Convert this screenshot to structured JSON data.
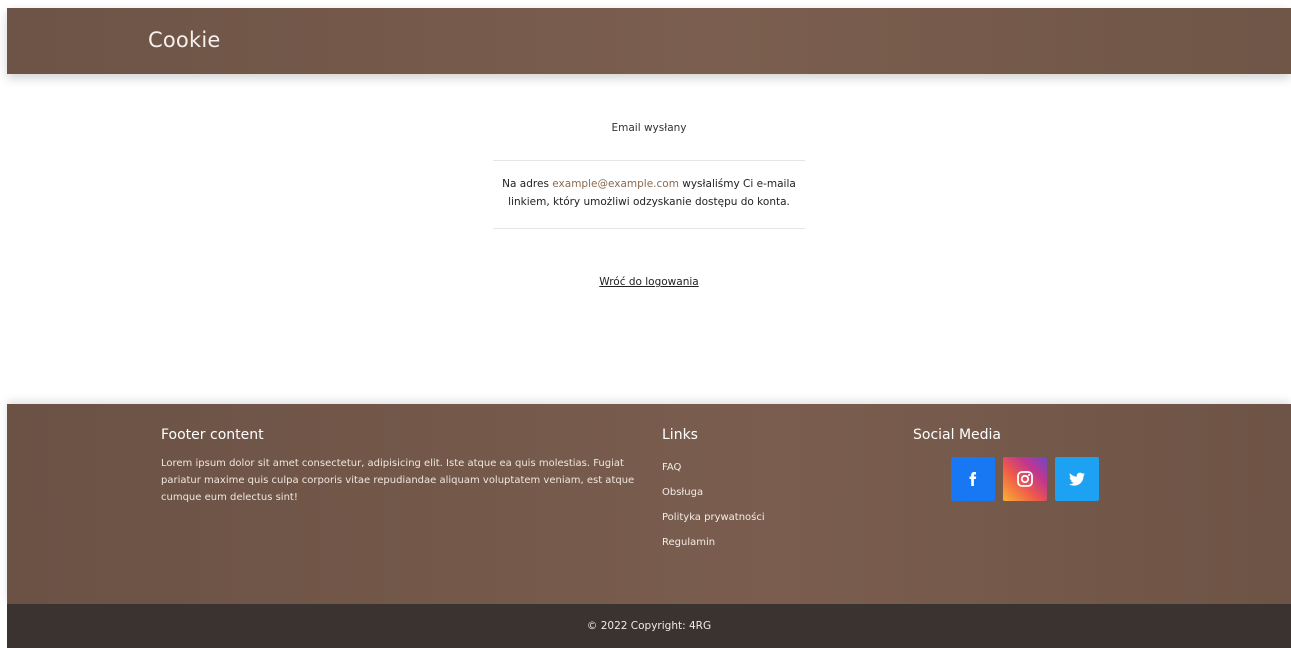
{
  "header": {
    "brand": "Cookie"
  },
  "main": {
    "title": "Email wysłany",
    "body_prefix": "Na adres ",
    "email": "example@example.com",
    "body_suffix": " wysłaliśmy Ci e-maila linkiem, który umożliwi odzyskanie dostępu do konta.",
    "back_link": "Wróć do logowania"
  },
  "footer": {
    "about_title": "Footer content",
    "about_text": "Lorem ipsum dolor sit amet consectetur, adipisicing elit. Iste atque ea quis molestias. Fugiat pariatur maxime quis culpa corporis vitae repudiandae aliquam voluptatem veniam, est atque cumque eum delectus sint!",
    "links_title": "Links",
    "links": [
      "FAQ",
      "Obsługa",
      "Polityka prywatności",
      "Regulamin"
    ],
    "social_title": "Social Media",
    "social": [
      {
        "name": "facebook-icon",
        "color": "#1877f2"
      },
      {
        "name": "instagram-icon",
        "color": "#e1306c"
      },
      {
        "name": "twitter-icon",
        "color": "#1da1f2"
      }
    ]
  },
  "copyright": "© 2022 Copyright: 4RG",
  "colors": {
    "brand_brown": "#74594a",
    "copyright_bg": "#3b3330",
    "email_link": "#8a6a52"
  }
}
